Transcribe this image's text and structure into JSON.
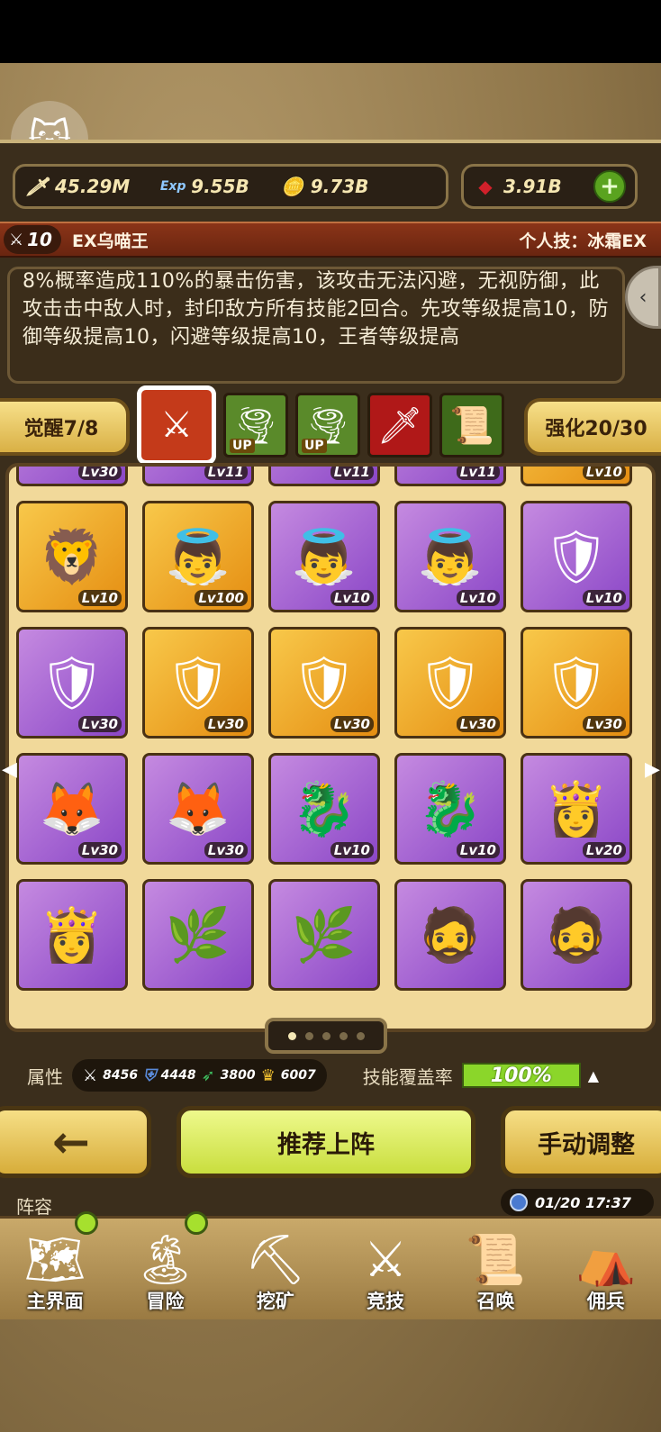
{
  "resources": {
    "attack": "45.29M",
    "exp": "9.55B",
    "gold": "9.73B",
    "gem": "3.91B"
  },
  "hero": {
    "level": "10",
    "name": "EX乌喵王",
    "personal_skill": "个人技：冰霜EX",
    "description": "8%概率造成110%的暴击伤害，该攻击无法闪避，无视防御，此攻击击中敌人时，封印敌方所有技能2回合。先攻等级提高10，防御等级提高10，闪避等级提高10，王者等级提高"
  },
  "awaken_label": "觉醒7/8",
  "enhance_label": "强化20/30",
  "skill_slots": [
    {
      "icon": "crossed-swords-icon",
      "selected": true,
      "up": ""
    },
    {
      "icon": "tornado-icon",
      "selected": false,
      "up": "UP"
    },
    {
      "icon": "tornado-icon",
      "selected": false,
      "up": "UP"
    },
    {
      "icon": "sword-icon",
      "selected": false,
      "up": ""
    },
    {
      "icon": "scroll-icon",
      "selected": false,
      "up": ""
    }
  ],
  "heroes": [
    {
      "portrait": "demon-knight",
      "bg": "purple",
      "lv": "Lv30"
    },
    {
      "portrait": "demon-knight",
      "bg": "purple",
      "lv": "Lv11"
    },
    {
      "portrait": "flame-warrior",
      "bg": "purple",
      "lv": "Lv11"
    },
    {
      "portrait": "flame-warrior",
      "bg": "purple",
      "lv": "Lv11"
    },
    {
      "portrait": "flame-warrior",
      "bg": "gold",
      "lv": "Lv10"
    },
    {
      "portrait": "lion-warrior",
      "bg": "gold",
      "lv": "Lv10"
    },
    {
      "portrait": "hooded-angel",
      "bg": "gold",
      "lv": "Lv100"
    },
    {
      "portrait": "hooded-angel",
      "bg": "purple",
      "lv": "Lv10"
    },
    {
      "portrait": "hooded-angel",
      "bg": "purple",
      "lv": "Lv10"
    },
    {
      "portrait": "golden-titan",
      "bg": "purple",
      "lv": "Lv10"
    },
    {
      "portrait": "golden-titan",
      "bg": "purple",
      "lv": "Lv30"
    },
    {
      "portrait": "golden-titan",
      "bg": "gold",
      "lv": "Lv30"
    },
    {
      "portrait": "golden-titan",
      "bg": "gold",
      "lv": "Lv30"
    },
    {
      "portrait": "golden-titan",
      "bg": "gold",
      "lv": "Lv30"
    },
    {
      "portrait": "golden-titan",
      "bg": "gold",
      "lv": "Lv30"
    },
    {
      "portrait": "fox-girl",
      "bg": "purple",
      "lv": "Lv30"
    },
    {
      "portrait": "fox-girl",
      "bg": "purple",
      "lv": "Lv30"
    },
    {
      "portrait": "dark-dragon",
      "bg": "purple",
      "lv": "Lv10"
    },
    {
      "portrait": "dark-dragon",
      "bg": "purple",
      "lv": "Lv10"
    },
    {
      "portrait": "priestess",
      "bg": "purple",
      "lv": "Lv20"
    },
    {
      "portrait": "priestess",
      "bg": "purple",
      "lv": ""
    },
    {
      "portrait": "leaf-boy",
      "bg": "purple",
      "lv": ""
    },
    {
      "portrait": "leaf-boy",
      "bg": "purple",
      "lv": ""
    },
    {
      "portrait": "bronze-warrior",
      "bg": "purple",
      "lv": ""
    },
    {
      "portrait": "bronze-warrior",
      "bg": "purple",
      "lv": ""
    }
  ],
  "pager": {
    "pages": 5,
    "current": 0
  },
  "attributes": {
    "label": "属性",
    "attack": "8456",
    "defense": "4448",
    "speed": "3800",
    "crown": "6007"
  },
  "coverage": {
    "label": "技能覆盖率",
    "value": "100%"
  },
  "buttons": {
    "back": "←",
    "recommend": "推荐上阵",
    "manual": "手动调整"
  },
  "footer": {
    "team_label": "阵容",
    "time": "01/20 17:37"
  },
  "nav": [
    {
      "label": "主界面",
      "icon": "map-icon",
      "notify": true
    },
    {
      "label": "冒险",
      "icon": "island-icon",
      "notify": true
    },
    {
      "label": "挖矿",
      "icon": "pickaxe-icon",
      "notify": false
    },
    {
      "label": "竞技",
      "icon": "swords-icon",
      "notify": false
    },
    {
      "label": "召唤",
      "icon": "scroll-icon",
      "notify": false
    },
    {
      "label": "佣兵",
      "icon": "tent-icon",
      "notify": false
    }
  ],
  "colors": {
    "gold_card": "#f8c84a",
    "purple_card": "#c58ae0",
    "coverage_bar": "#8bd62a",
    "title_bar": "#8a3418"
  }
}
